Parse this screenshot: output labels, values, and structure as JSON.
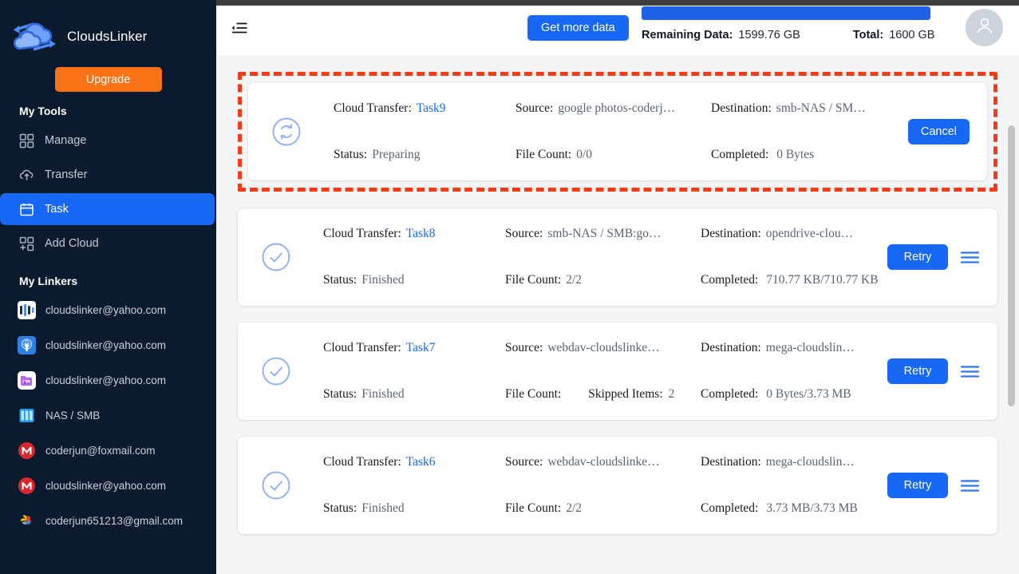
{
  "sidebar": {
    "brand": {
      "name": "CloudsLinker",
      "logo_icon": "clouds-linker-logo-icon"
    },
    "upgrade_label": "Upgrade",
    "tools_label": "My Tools",
    "nav_items": [
      {
        "label": "Manage",
        "icon": "grid-icon",
        "active": false
      },
      {
        "label": "Transfer",
        "icon": "cloud-upload-icon",
        "active": false
      },
      {
        "label": "Task",
        "icon": "calendar-icon",
        "active": true
      },
      {
        "label": "Add Cloud",
        "icon": "add-grid-icon",
        "active": false
      }
    ],
    "linkers_label": "My Linkers",
    "linkers": [
      {
        "label": "cloudslinker@yahoo.com",
        "icon": "opendrive-icon"
      },
      {
        "label": "cloudslinker@yahoo.com",
        "icon": "webdav-icon"
      },
      {
        "label": "cloudslinker@yahoo.com",
        "icon": "photos-folder-icon"
      },
      {
        "label": "NAS / SMB",
        "icon": "nas-smb-icon"
      },
      {
        "label": "coderjun@foxmail.com",
        "icon": "mega-icon"
      },
      {
        "label": "cloudslinker@yahoo.com",
        "icon": "mega-icon"
      },
      {
        "label": "coderjun651213@gmail.com",
        "icon": "google-photos-icon"
      }
    ]
  },
  "topbar": {
    "collapse_icon": "collapse-sidebar-icon",
    "get_more_label": "Get more data",
    "remaining_label": "Remaining Data:",
    "remaining_value": "1599.76 GB",
    "total_label": "Total:",
    "total_value": "1600 GB",
    "progress_percent": 99.98,
    "avatar_icon": "user-avatar-icon"
  },
  "labels": {
    "transfer": "Cloud Transfer:",
    "source": "Source:",
    "destination": "Destination:",
    "status": "Status:",
    "file_count": "File Count:",
    "completed": "Completed:",
    "skipped": "Skipped Items:"
  },
  "tasks": [
    {
      "name": "Task9",
      "source": "google photos-coderj…",
      "destination": "smb-NAS / SM…",
      "status": "Preparing",
      "file_count": "0/0",
      "skipped": null,
      "completed": "0 Bytes",
      "action_label": "Cancel",
      "state_icon": "sync-circle-icon",
      "has_menu": false,
      "highlighted": true
    },
    {
      "name": "Task8",
      "source": "smb-NAS / SMB:go…",
      "destination": "opendrive-clou…",
      "status": "Finished",
      "file_count": "2/2",
      "skipped": null,
      "completed": "710.77 KB/710.77 KB",
      "action_label": "Retry",
      "state_icon": "check-circle-icon",
      "has_menu": true,
      "highlighted": false
    },
    {
      "name": "Task7",
      "source": "webdav-cloudslinke…",
      "destination": "mega-cloudslin…",
      "status": "Finished",
      "file_count": "",
      "skipped": "2",
      "completed": "0 Bytes/3.73 MB",
      "action_label": "Retry",
      "state_icon": "check-circle-icon",
      "has_menu": true,
      "highlighted": false
    },
    {
      "name": "Task6",
      "source": "webdav-cloudslinke…",
      "destination": "mega-cloudslin…",
      "status": "Finished",
      "file_count": "2/2",
      "skipped": null,
      "completed": "3.73 MB/3.73 MB",
      "action_label": "Retry",
      "state_icon": "check-circle-icon",
      "has_menu": true,
      "highlighted": false
    }
  ],
  "colors": {
    "accent": "#1668f5",
    "upgrade": "#f97316",
    "highlight": "#f63b14",
    "sidebar_bg": "#0b1a2d"
  }
}
